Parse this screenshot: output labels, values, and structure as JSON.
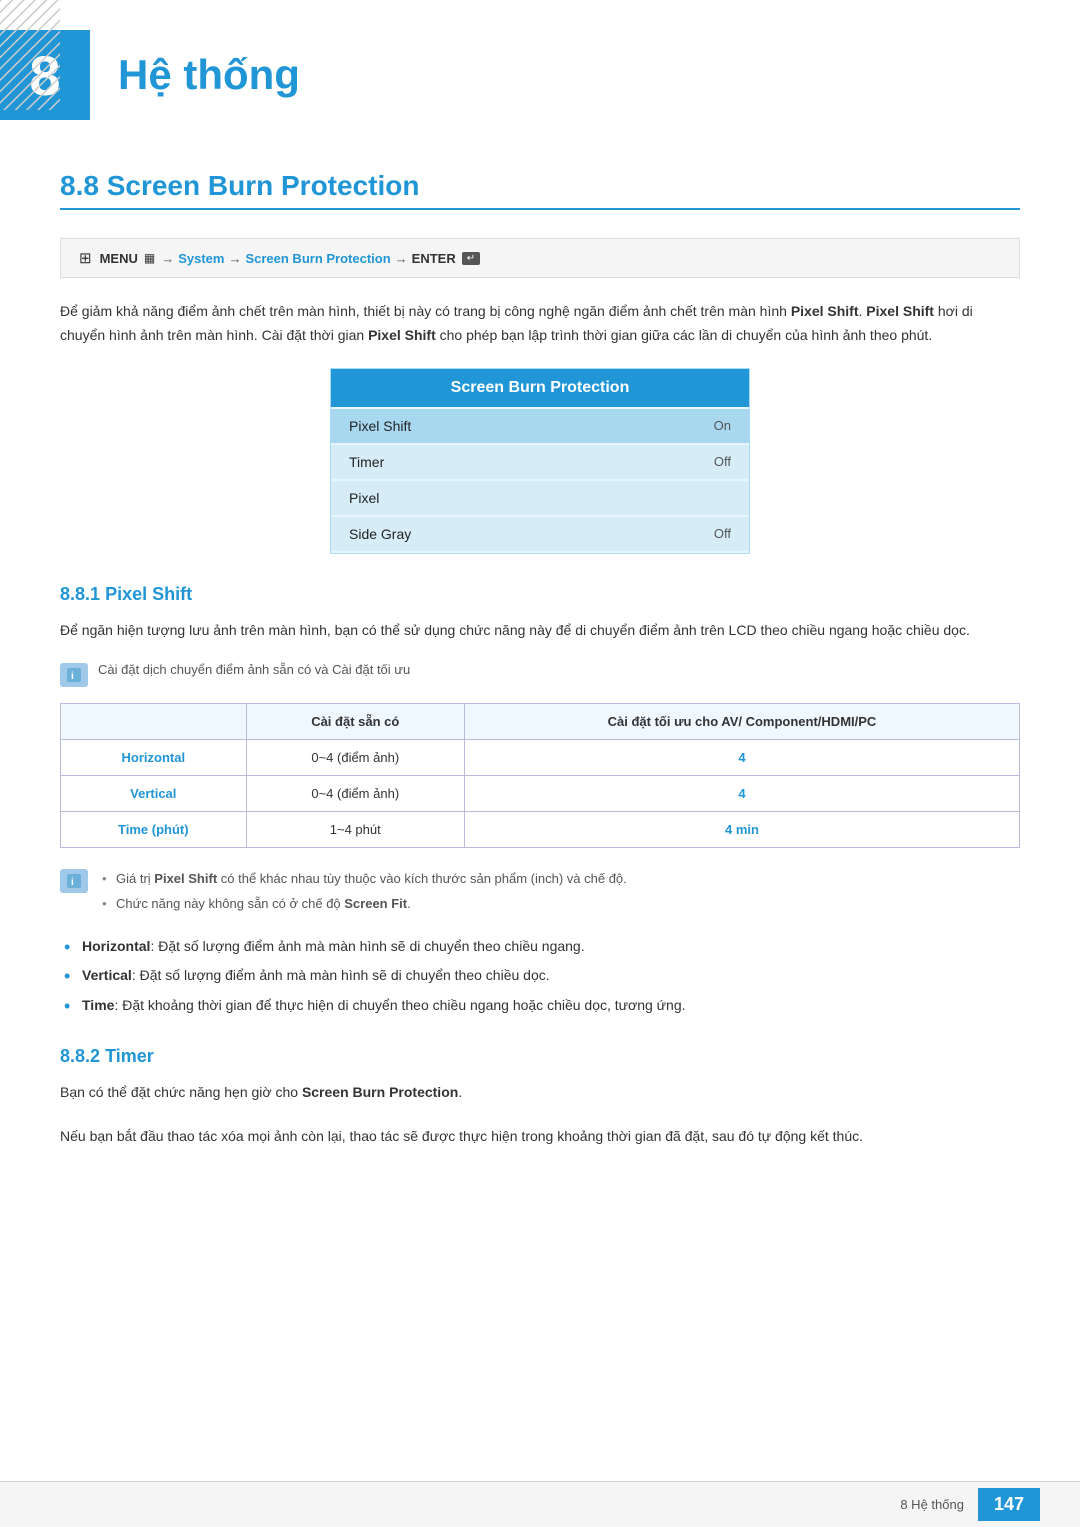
{
  "header": {
    "chapter_number": "8",
    "chapter_title": "Hệ thống",
    "hatch_pattern": "diagonal lines"
  },
  "section": {
    "number": "8.8",
    "title": "Screen Burn Protection"
  },
  "nav": {
    "menu_label": "MENU",
    "arrow1": "→",
    "system_label": "System",
    "arrow2": "→",
    "screen_burn_label": "Screen Burn Protection",
    "arrow3": "→",
    "enter_label": "ENTER"
  },
  "intro_paragraph": "Để giảm khả năng điểm ảnh chết trên màn hình, thiết bị này có trang bị công nghệ ngăn điểm ảnh chết trên màn hình Pixel Shift. Pixel Shift hơi di chuyển hình ảnh trên màn hình. Cài đặt thời gian Pixel Shift cho phép bạn lập trình thời gian giữa các lần di chuyển của hình ảnh theo phút.",
  "ui_box": {
    "header": "Screen Burn Protection",
    "items": [
      {
        "label": "Pixel Shift",
        "value": "On",
        "selected": true
      },
      {
        "label": "Timer",
        "value": "Off",
        "selected": false
      },
      {
        "label": "Pixel",
        "value": "",
        "selected": false
      },
      {
        "label": "Side Gray",
        "value": "Off",
        "selected": false
      }
    ]
  },
  "subsection_881": {
    "number": "8.8.1",
    "title": "Pixel Shift"
  },
  "pixel_shift_desc": "Để ngăn hiện tượng lưu ảnh trên màn hình, bạn có thể sử dụng chức năng này để di chuyển điểm ảnh trên LCD theo chiều ngang hoặc chiều dọc.",
  "note_pixel_shift": "Cài đặt dịch chuyển điểm ảnh sẵn có và Cài đặt tối ưu",
  "table": {
    "headers": [
      "",
      "Cài đặt sẵn có",
      "Cài đặt tối ưu cho AV/ Component/HDMI/PC"
    ],
    "rows": [
      {
        "label": "Horizontal",
        "preset": "0~4 (điểm ảnh)",
        "optimal": "4"
      },
      {
        "label": "Vertical",
        "preset": "0~4 (điểm ảnh)",
        "optimal": "4"
      },
      {
        "label": "Time (phút)",
        "preset": "1~4 phút",
        "optimal": "4 min"
      }
    ]
  },
  "note_items": [
    "Giá trị Pixel Shift có thể khác nhau tùy thuộc vào kích thước sản phẩm (inch) và chế độ.",
    "Chức năng này không sẵn có ở chế độ Screen Fit."
  ],
  "main_bullets": [
    {
      "bold_part": "Horizontal",
      "text": ": Đặt số lượng điểm ảnh mà màn hình sẽ di chuyển theo chiều ngang."
    },
    {
      "bold_part": "Vertical",
      "text": ": Đặt số lượng điểm ảnh mà màn hình sẽ di chuyển theo chiều dọc."
    },
    {
      "bold_part": "Time",
      "text": ": Đặt khoảng thời gian để thực hiện di chuyển theo chiều ngang hoặc chiều dọc, tương ứng."
    }
  ],
  "subsection_882": {
    "number": "8.8.2",
    "title": "Timer"
  },
  "timer_desc1": "Bạn có thể đặt chức năng hẹn giờ cho Screen Burn Protection.",
  "timer_desc2": "Nếu bạn bắt đầu thao tác xóa mọi ảnh còn lại, thao tác sẽ được thực hiện trong khoảng thời gian đã đặt, sau đó tự động kết thúc.",
  "footer": {
    "text": "8 Hệ thống",
    "page_number": "147"
  }
}
